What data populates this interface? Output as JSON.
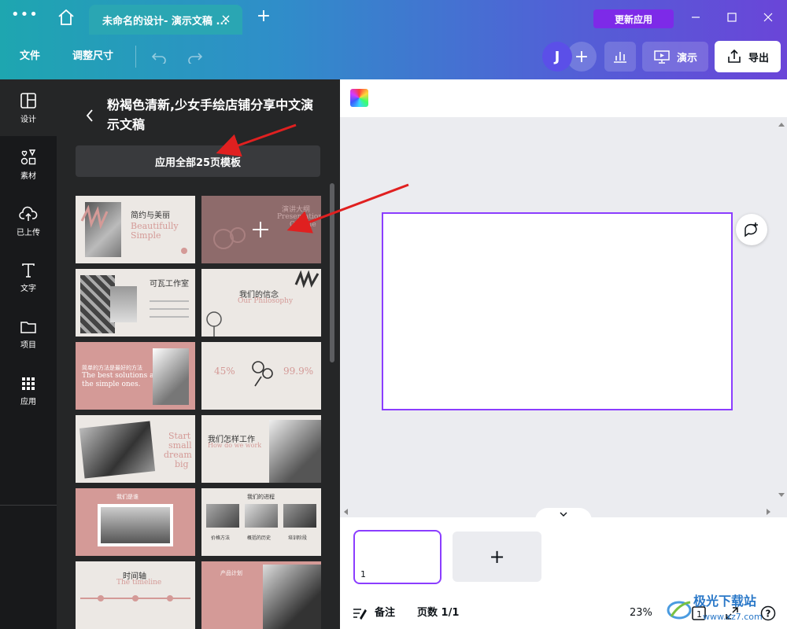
{
  "titlebar": {
    "tab_title": "未命名的设计- 演示文稿 ...",
    "update_label": "更新应用"
  },
  "toolbar": {
    "file_label": "文件",
    "resize_label": "调整尺寸",
    "avatar_initial": "J",
    "present_label": "演示",
    "export_label": "导出"
  },
  "rail": {
    "items": [
      {
        "label": "设计",
        "icon": "layout-icon"
      },
      {
        "label": "素材",
        "icon": "shapes-icon"
      },
      {
        "label": "已上传",
        "icon": "upload-cloud-icon"
      },
      {
        "label": "文字",
        "icon": "text-icon"
      },
      {
        "label": "项目",
        "icon": "folder-icon"
      },
      {
        "label": "应用",
        "icon": "apps-grid-icon"
      }
    ]
  },
  "panel": {
    "title": "粉褐色清新,少女手绘店铺分享中文演示文稿",
    "apply_all_label": "应用全部25页模板"
  },
  "templates": {
    "t1": {
      "zh": "简约与美丽",
      "en1": "Beautifully",
      "en2": "Simple"
    },
    "t2": {
      "zh": "演讲大纲",
      "en1": "Presentation",
      "en2": "Outline"
    },
    "t3": {
      "zh": "可瓦工作室"
    },
    "t4": {
      "zh": "我们的信念",
      "en1": "Our Philosophy"
    },
    "t5": {
      "zh": "简单的方法是最好的方法",
      "en1": "The best solutions are",
      "en2": "the simple ones."
    },
    "t6": {
      "v1": "45%",
      "v2": "99.9%"
    },
    "t7": {
      "en1": "Start",
      "en2": "small",
      "en3": "dream",
      "en4": "big"
    },
    "t8": {
      "zh": "我们怎样工作",
      "en1": "How do we work"
    },
    "t9": {
      "zh": "我们是谁"
    },
    "t10": {
      "zh": "我们的进程",
      "c1": "价格方法",
      "c2": "概括的历史",
      "c3": "培训阶段"
    },
    "t11": {
      "zh": "时间轴",
      "en1": "The timeline"
    },
    "t12": {
      "zh": "产品计划"
    }
  },
  "bottom": {
    "page_number": "1",
    "notes_label": "备注",
    "page_count": "页数 1/1",
    "zoom": "23%",
    "help": "?",
    "fullscreen_num": "1"
  },
  "watermark": {
    "text_cn": "极光下载站",
    "text_url": "www.xz7.com"
  },
  "colors": {
    "accent_purple": "#8b3dff",
    "update_purple": "#7d2ae8",
    "dusty_pink": "#d49a97",
    "annotation_red": "#e02020"
  }
}
